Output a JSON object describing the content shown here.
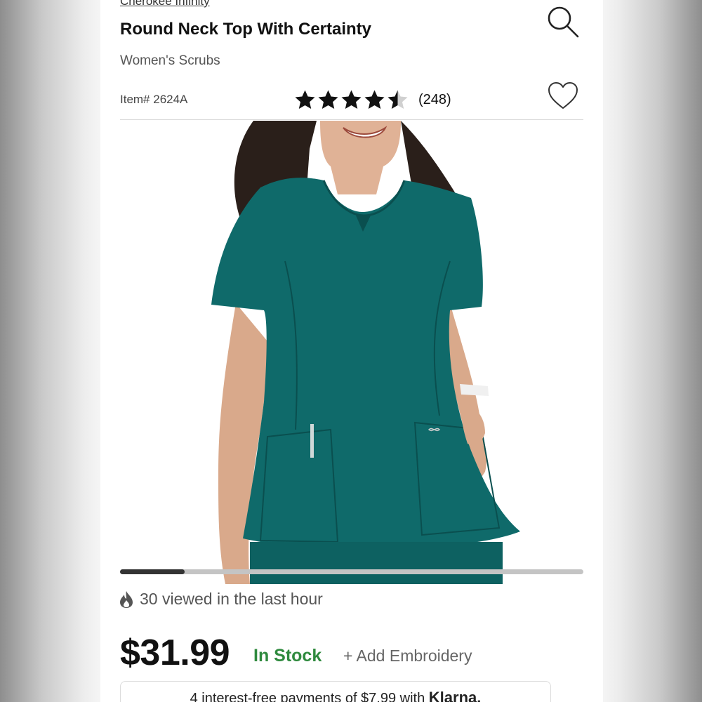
{
  "header": {
    "brand": "Cherokee Infinity",
    "title": "Round Neck Top With Certainty",
    "category": "Women's Scrubs",
    "search_icon": "search-icon",
    "favorite_icon": "heart-outline-icon"
  },
  "product": {
    "item_number": "Item# 2624A",
    "rating": 4.5,
    "rating_max": 5,
    "review_count": "(248)",
    "image": {
      "subject": "woman wearing teal round neck scrub top",
      "garment_color": "#0f6a6a"
    },
    "carousel_progress": 0.14
  },
  "social_proof": {
    "icon": "flame-icon",
    "text": "30 viewed in the last hour"
  },
  "purchase": {
    "price": "$31.99",
    "stock_status": "In Stock",
    "embroidery_link": "+ Add Embroidery"
  },
  "klarna": {
    "text": "4 interest-free payments of $7.99 with",
    "brand": "Klarna."
  },
  "colors": {
    "in_stock": "#2f8a3e",
    "scrub_teal": "#0f6a6a",
    "progress_active": "#333333",
    "progress_track": "#c4c4c4"
  }
}
